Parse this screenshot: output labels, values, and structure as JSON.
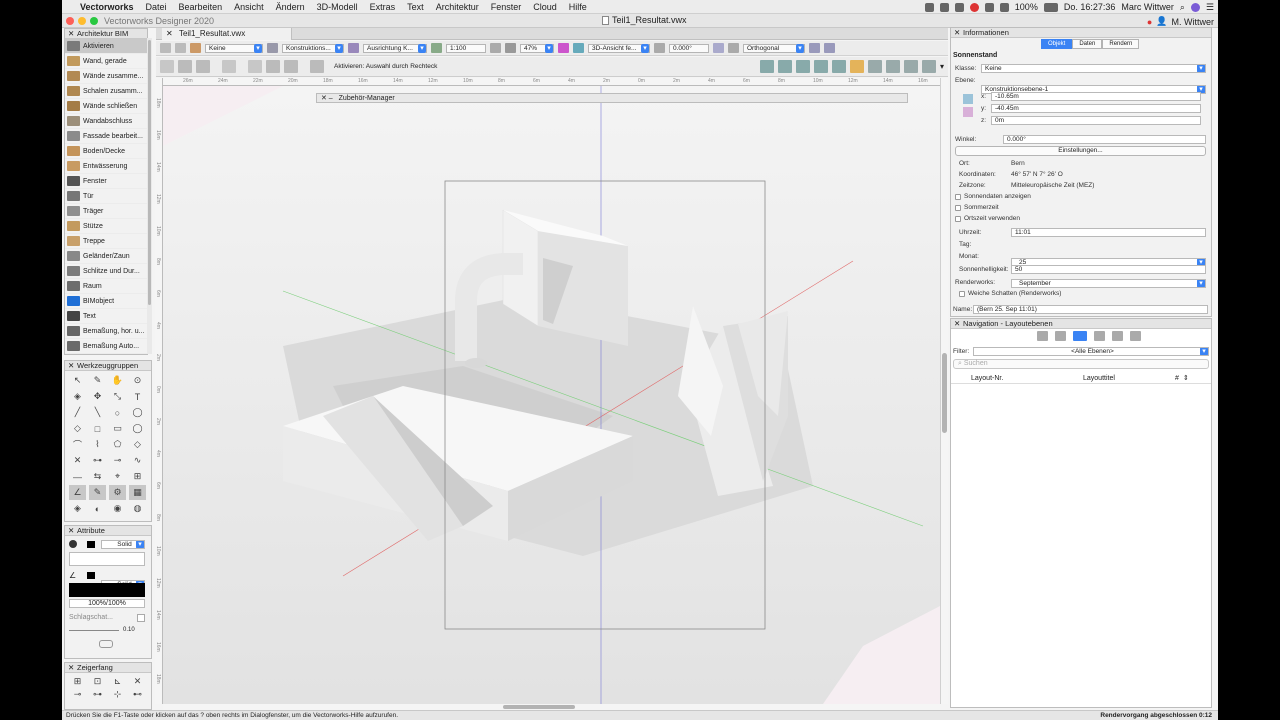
{
  "menubar": {
    "app_name": "Vectorworks",
    "items": [
      "Datei",
      "Bearbeiten",
      "Ansicht",
      "Ändern",
      "3D-Modell",
      "Extras",
      "Text",
      "Architektur",
      "Fenster",
      "Cloud",
      "Hilfe"
    ],
    "battery": "100%",
    "clock": "Do. 16:27:36",
    "user": "Marc Wittwer"
  },
  "window": {
    "app_title": "Vectorworks Designer 2020",
    "doc_title": "Teil1_Resultat.vwx",
    "tab_label": "Teil1_Resultat.vwx",
    "user_short": "M. Wittwer"
  },
  "toolbar": {
    "class_value": "Keine",
    "layer_value": "Konstruktions...",
    "align_value": "Ausrichtung K...",
    "scale_value": "1:100",
    "zoom_value": "47%",
    "view_value": "3D-Ansicht fe...",
    "angle_value": "0.000°",
    "projection_value": "Orthogonal",
    "mode_hint": "Aktivieren: Auswahl durch Rechteck"
  },
  "ruler": {
    "top_labels": [
      "26m",
      "24m",
      "22m",
      "20m",
      "18m",
      "16m",
      "14m",
      "12m",
      "10m",
      "8m",
      "6m",
      "4m",
      "2m",
      "0m",
      "2m",
      "4m",
      "6m",
      "8m",
      "10m",
      "12m",
      "14m",
      "16m"
    ],
    "left_labels": [
      "18m",
      "16m",
      "14m",
      "12m",
      "10m",
      "8m",
      "6m",
      "4m",
      "2m",
      "0m",
      "2m",
      "4m",
      "6m",
      "8m",
      "10m",
      "12m",
      "14m",
      "16m",
      "18m"
    ]
  },
  "bim_palette": {
    "title": "Architektur BIM",
    "tools": [
      {
        "label": "Aktivieren",
        "color": "#7a7a7a",
        "active": true
      },
      {
        "label": "Wand, gerade",
        "color": "#c29a5c"
      },
      {
        "label": "Wände zusamme...",
        "color": "#b28a54"
      },
      {
        "label": "Schalen zusamm...",
        "color": "#b08850"
      },
      {
        "label": "Wände schließen",
        "color": "#a47c46"
      },
      {
        "label": "Wandabschluss",
        "color": "#9c8f7a"
      },
      {
        "label": "Fassade bearbeit...",
        "color": "#8b8b8b"
      },
      {
        "label": "Boden/Decke",
        "color": "#c4945a"
      },
      {
        "label": "Entwässerung",
        "color": "#c89b62"
      },
      {
        "label": "Fenster",
        "color": "#555555"
      },
      {
        "label": "Tür",
        "color": "#777777"
      },
      {
        "label": "Träger",
        "color": "#8f8f8f"
      },
      {
        "label": "Stütze",
        "color": "#c39a5e"
      },
      {
        "label": "Treppe",
        "color": "#c8a06a"
      },
      {
        "label": "Geländer/Zaun",
        "color": "#888888"
      },
      {
        "label": "Schlitze und Dur...",
        "color": "#7c7c7c"
      },
      {
        "label": "Raum",
        "color": "#6d6d6d"
      },
      {
        "label": "BIMobject",
        "color": "#1f6fd6"
      },
      {
        "label": "Text",
        "color": "#444444"
      },
      {
        "label": "Bemaßung, hor. u...",
        "color": "#666666"
      },
      {
        "label": "Bemaßung Auto...",
        "color": "#6a6a6a"
      }
    ]
  },
  "tool_groups": {
    "title": "Werkzeuggruppen"
  },
  "attributes": {
    "title": "Attribute",
    "fill_style": "Solid",
    "pen_style": "Solid",
    "opacity": "100%/100%",
    "shadow_label": "Schlagschat...",
    "line_weight": "0.10"
  },
  "snap": {
    "title": "Zeigerfang"
  },
  "accessory_manager": {
    "title": "Zubehör-Manager"
  },
  "info_palette": {
    "title": "Informationen",
    "tabs": [
      "Objekt",
      "Daten",
      "Rendern"
    ],
    "object_name": "Sonnenstand",
    "class_label": "Klasse:",
    "class_value": "Keine",
    "layer_label": "Ebene:",
    "layer_value": "Konstruktionsebene-1",
    "x_label": "x:",
    "x_value": "-10.65m",
    "y_label": "y:",
    "y_value": "-40.45m",
    "z_label": "z:",
    "z_value": "0m",
    "angle_label": "Winkel:",
    "angle_value": "0.000°",
    "settings_button": "Einstellungen...",
    "location_label": "Ort:",
    "location_value": "Bern",
    "coords_label": "Koordinaten:",
    "coords_value": "46° 57'  N 7° 26'  O",
    "timezone_label": "Zeitzone:",
    "timezone_value": "Mitteleuropäische Zeit (MEZ)",
    "chk_sundata": "Sonnendaten anzeigen",
    "chk_summer": "Sommerzeit",
    "chk_local": "Ortszeit verwenden",
    "time_label": "Uhrzeit:",
    "time_value": "11:01",
    "day_label": "Tag:",
    "day_value": "25",
    "month_label": "Monat:",
    "month_value": "September",
    "brightness_label": "Sonnenhelligkeit:",
    "brightness_value": "50",
    "renderworks_label": "Renderworks:",
    "chk_soft_shadows": "Weiche Schatten (Renderworks)",
    "name_label": "Name:",
    "name_value": "(Bern 25. Sep 11:01)"
  },
  "nav_palette": {
    "title": "Navigation - Layoutebenen",
    "filter_label": "Filter:",
    "filter_value": "<Alle Ebenen>",
    "search_placeholder": "Suchen",
    "col_number": "Layout-Nr.",
    "col_title": "Layouttitel",
    "col_hash": "#"
  },
  "status": {
    "hint": "Drücken Sie die F1-Taste oder klicken auf das ? oben rechts im Dialogfenster, um die Vectorworks-Hilfe aufzurufen.",
    "render_status": "Rendervorgang abgeschlossen 0:12"
  }
}
